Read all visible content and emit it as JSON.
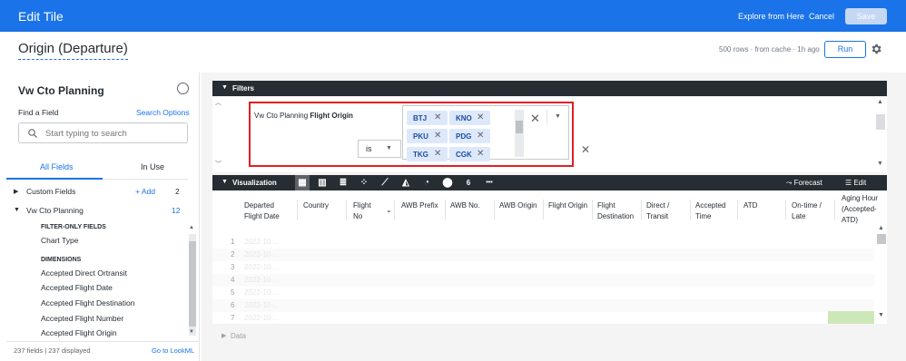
{
  "topbar": {
    "title": "Edit Tile",
    "explore_label": "Explore from Here",
    "cancel_label": "Cancel",
    "save_label": "Save",
    "color": "#1a73e8"
  },
  "header": {
    "page_title": "Origin (Departure)",
    "meta": "500 rows · from cache · 1h ago",
    "run_label": "Run",
    "settings_icon": "gear-icon"
  },
  "sidebar": {
    "title": "Vw Cto Planning",
    "find_label": "Find a Field",
    "search_options_label": "Search Options",
    "search_placeholder": "Start typing to search",
    "tabs": [
      "All Fields",
      "In Use"
    ],
    "groups": [
      {
        "label": "Custom Fields",
        "add_label": "+ Add",
        "count": "2"
      },
      {
        "label": "Vw Cto Planning",
        "count": "12"
      }
    ],
    "filter_only_label": "FILTER-ONLY FIELDS",
    "filter_only_items": [
      "Chart Type"
    ],
    "dimensions_label": "DIMENSIONS",
    "dimension_items": [
      "Accepted Direct Ortransit",
      "Accepted Flight Date",
      "Accepted Flight Destination",
      "Accepted Flight Number",
      "Accepted Flight Origin"
    ],
    "footer_count": "237 fields | 237 displayed",
    "footer_link": "Go to LookML"
  },
  "filters": {
    "section_label": "Filters",
    "field_view": "Vw Cto Planning",
    "field_name": "Flight Origin",
    "operator": "is",
    "values": [
      "BTJ",
      "KNO",
      "PKU",
      "PDG",
      "TKG",
      "CGK"
    ]
  },
  "visualization": {
    "section_label": "Visualization",
    "forecast_label": "Forecast",
    "edit_label": "Edit",
    "tools": [
      "table-icon",
      "bar-chart-icon",
      "text-icon",
      "scatter-icon",
      "line-chart-icon",
      "area-chart-icon",
      "pie-chart-icon",
      "map-pin-icon",
      "single-value-icon",
      "more-icon"
    ],
    "single_value_glyph": "6",
    "more_glyph": "•••"
  },
  "table": {
    "columns": [
      "Departed Flight Date",
      "Country",
      "Flight No",
      "AWB Prefix",
      "AWB No.",
      "AWB Origin",
      "Flight Origin",
      "Flight Destination",
      "Direct / Transit",
      "Accepted Time",
      "ATD",
      "On-time / Late",
      "Aging Hour (Accepted-ATD)"
    ],
    "row_numbers": [
      "1",
      "2",
      "3",
      "4",
      "5",
      "6",
      "7"
    ],
    "faded_cell": "2022-10-..."
  },
  "data_section": {
    "label": "Data"
  }
}
